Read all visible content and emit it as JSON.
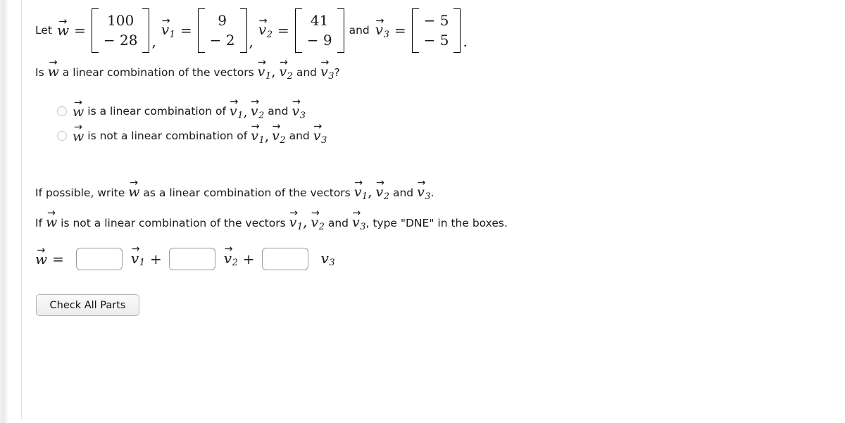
{
  "problem": {
    "let_label": "Let",
    "and_word": "and",
    "equals": "=",
    "comma": ",",
    "period": ".",
    "vectors": [
      {
        "name": "w",
        "subscript": "",
        "accent": "arrow",
        "entries": [
          "100",
          "− 28"
        ]
      },
      {
        "name": "v",
        "subscript": "1",
        "accent": "arrow",
        "entries": [
          "9",
          "− 2"
        ]
      },
      {
        "name": "v",
        "subscript": "2",
        "accent": "arrow",
        "entries": [
          "41",
          "− 9"
        ]
      },
      {
        "name": "v",
        "subscript": "3",
        "accent": "arrow",
        "entries": [
          "− 5",
          "− 5"
        ]
      }
    ]
  },
  "question": {
    "text_before": "Is",
    "subject": "w",
    "text_after": "a linear combination of the vectors",
    "v1": "v",
    "v1_sub": "1",
    "v2": "v",
    "v2_sub": "2",
    "and_word": "and",
    "v3": "v",
    "v3_sub": "3",
    "terminator": "?"
  },
  "choices": [
    {
      "subject": "w",
      "text": "is a linear combination of",
      "v1": "v",
      "v1_sub": "1",
      "v2": "v",
      "v2_sub": "2",
      "and_word": "and",
      "v3": "v",
      "v3_sub": "3",
      "selected": false
    },
    {
      "subject": "w",
      "text": "is not a linear combination of",
      "v1": "v",
      "v1_sub": "1",
      "v2": "v",
      "v2_sub": "2",
      "and_word": "and",
      "v3": "v",
      "v3_sub": "3",
      "selected": false
    }
  ],
  "instructions": [
    {
      "part1": "If possible, write",
      "subject": "w",
      "part2": "as a linear combination of the vectors",
      "v1": "v",
      "v1_sub": "1",
      "v2": "v",
      "v2_sub": "2",
      "and_word": "and",
      "v3": "v",
      "v3_sub": "3",
      "terminator": "."
    },
    {
      "part1": "If",
      "subject": "w",
      "part2": "is not a linear combination of the vectors",
      "v1": "v",
      "v1_sub": "1",
      "v2": "v",
      "v2_sub": "2",
      "and_word": "and",
      "v3": "v",
      "v3_sub": "3",
      "terminator": ", type \"DNE\" in the boxes."
    }
  ],
  "answer_row": {
    "lhs": "w",
    "equals": "=",
    "plus": "+",
    "term1": "v",
    "term1_sub": "1",
    "term1_accent": "arrow",
    "term2": "v",
    "term2_sub": "2",
    "term2_accent": "arrow",
    "term3": "v",
    "term3_sub": "3",
    "term3_accent": "none",
    "inputs": [
      {
        "value": "",
        "placeholder": ""
      },
      {
        "value": "",
        "placeholder": ""
      },
      {
        "value": "",
        "placeholder": ""
      }
    ]
  },
  "button": {
    "label": "Check All Parts"
  },
  "colors": {
    "text": "#1a1a1a",
    "input_border": "#9a9a9a",
    "radio_border": "#c8c8c8",
    "button_border": "#b4b4b4",
    "divider": "#e2e2e6"
  }
}
